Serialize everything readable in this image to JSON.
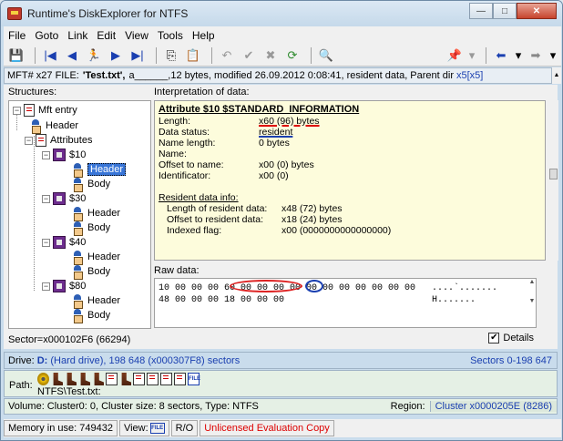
{
  "window": {
    "title": "Runtime's DiskExplorer for NTFS",
    "min_label": "—",
    "max_label": "□",
    "close_label": "✕"
  },
  "menu": [
    "File",
    "Goto",
    "Link",
    "Edit",
    "View",
    "Tools",
    "Help"
  ],
  "toolbar": {
    "icons": [
      "save-icon",
      "first-icon",
      "prev-icon",
      "runner-icon",
      "next-icon",
      "last-icon",
      "copy-icon",
      "paste-icon",
      "undo-icon",
      "stamp-icon",
      "check-icon",
      "cancel-icon",
      "refresh-icon",
      "preview-icon",
      "pin-icon",
      "pin-dropdown-icon",
      "back-arrow-icon",
      "back-dropdown-icon",
      "forward-arrow-icon",
      "forward-dropdown-icon"
    ],
    "glyphs": {
      "save": "💾",
      "first": "|◀",
      "prev": "◀",
      "runner": "🏃",
      "next": "▶",
      "last": "▶|",
      "copy": "⎘",
      "paste": "📋",
      "undo": "↶",
      "check": "✔",
      "cancel": "✖",
      "refresh": "⟳",
      "preview": "🔍",
      "pin": "📌",
      "dropdown": "▾",
      "back": "⬅",
      "forward": "➡"
    }
  },
  "infobar": {
    "mft": "MFT# x27  FILE:",
    "filename": "'Test.txt',",
    "attrs": "a______,",
    "details": " 12 bytes, modified 26.09.2012 0:08:41, resident data, Parent dir",
    "parent_link": "x5[x5]"
  },
  "structures": {
    "label": "Structures:",
    "root": "Mft entry",
    "header": "Header",
    "attributes": "Attributes",
    "attr_groups": [
      "$10",
      "$30",
      "$40",
      "$80"
    ],
    "child_header": "Header",
    "child_body": "Body"
  },
  "interpretation": {
    "label": "Interpretation of data:",
    "title": "Attribute $10  $STANDARD_INFORMATION",
    "rows": [
      {
        "k": "Length:",
        "v": "x60 (96) bytes"
      },
      {
        "k": "Data status:",
        "v": "resident"
      },
      {
        "k": "Name length:",
        "v": "0 bytes"
      },
      {
        "k": "Name:",
        "v": ""
      },
      {
        "k": "Offset to name:",
        "v": "x00 (0) bytes"
      },
      {
        "k": "Identificator:",
        "v": "x00 (0)"
      }
    ],
    "resident_title": "Resident data info:",
    "resident_rows": [
      {
        "k": "Length of resident data:",
        "v": "x48 (72) bytes"
      },
      {
        "k": "Offset to resident data:",
        "v": "x18 (24) bytes"
      },
      {
        "k": "Indexed flag:",
        "v": "x00 (0000000000000000)"
      }
    ]
  },
  "raw": {
    "label": "Raw data:",
    "line1": "10 00 00 00 60 00 00 00 00 00 00 00 00 00 00 00   ....`.......",
    "line2": "48 00 00 00 18 00 00 00                           H......."
  },
  "sector": "Sector=x000102F6 (66294)",
  "details_label": "Details",
  "details_checked": "✔",
  "drive": {
    "label": "Drive:",
    "drive": "D:",
    "rest": "(Hard drive), 198 648 (x000307F8) sectors",
    "range": "Sectors 0-198 647"
  },
  "path": {
    "label": "Path:",
    "text": "NTFS\\Test.txt:",
    "file_badge": "FILE"
  },
  "volume": {
    "info": "Volume:  Cluster0: 0, Cluster size: 8 sectors, Type: NTFS",
    "region_label": "Region:",
    "region_value": "Cluster x0000205E (8286)"
  },
  "status": {
    "memory": "Memory in use: 749432",
    "view": "View:",
    "view_badge": "FILE",
    "mode": "R/O",
    "license": "Unlicensed Evaluation Copy"
  }
}
